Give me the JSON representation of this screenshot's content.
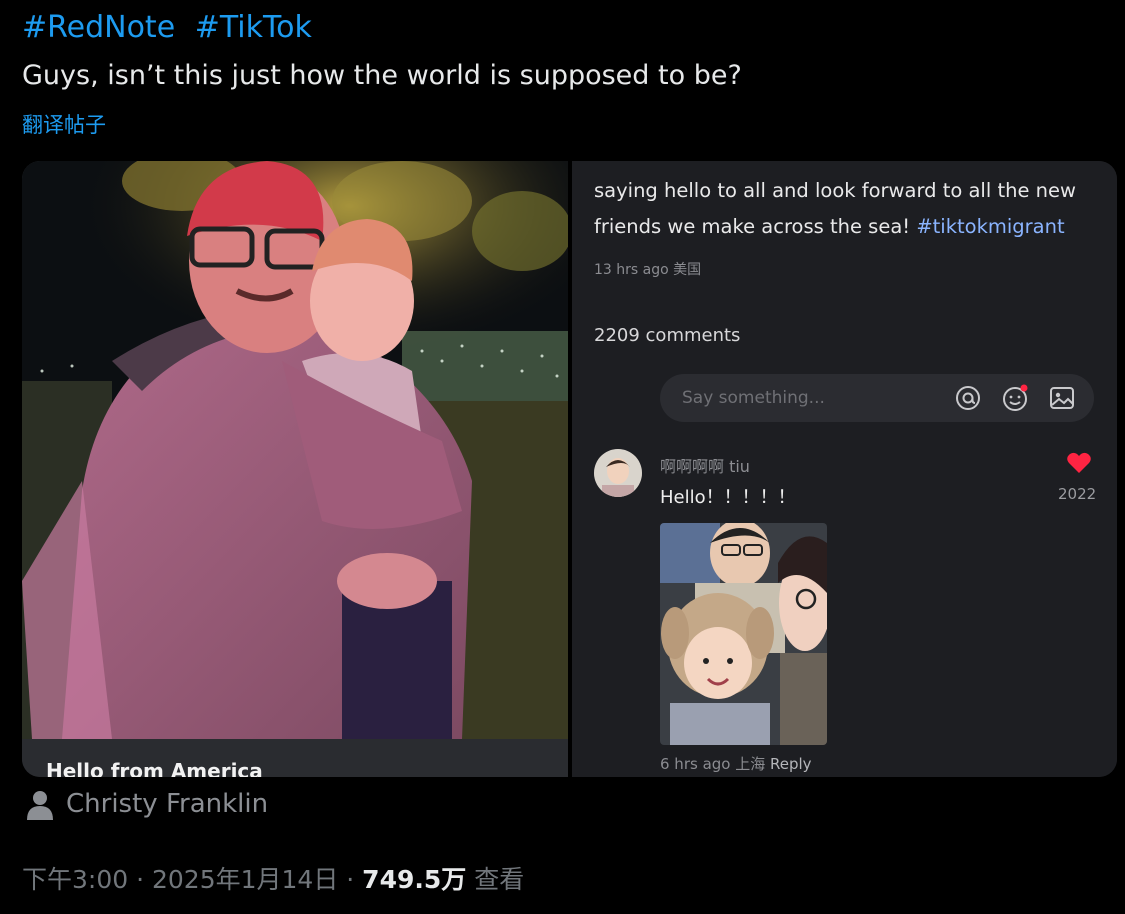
{
  "tweet": {
    "hashtags": [
      "#RedNote",
      "#TikTok"
    ],
    "text": "Guys, isn’t this just how the world is supposed to be?",
    "translate_label": "翻译帖子",
    "author_name": "Christy Franklin",
    "time": "下午3:00",
    "date": "2025年1月14日",
    "separator": " · ",
    "views": "749.5万",
    "views_label": "查看"
  },
  "embedded": {
    "photo_caption": "Hello from America",
    "post_text": "saying hello to all and look forward to all the new friends we make across the sea! ",
    "post_tag": "#tiktokmigrant",
    "post_meta": "13 hrs ago 美国",
    "comments_count": "2209 comments",
    "input_placeholder": "Say something...",
    "icons": [
      "at-icon",
      "emoji-icon",
      "image-icon"
    ],
    "comment": {
      "user": "啊啊啊啊 tiu",
      "text": "Hello！！！！！",
      "likes": "2022",
      "meta": "6 hrs ago 上海",
      "reply_label": "Reply"
    }
  },
  "colors": {
    "link": "#1d9bf0",
    "background": "#000000",
    "heart": "#ff2442"
  }
}
